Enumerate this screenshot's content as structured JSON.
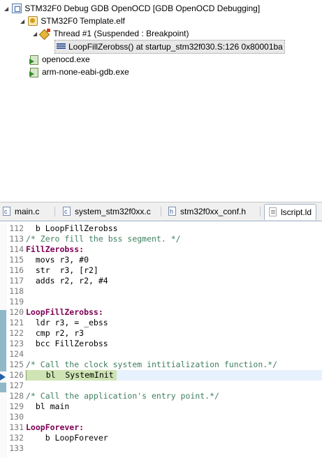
{
  "debug_tree": {
    "launch": {
      "label": "STM32F0 Debug GDB OpenOCD [GDB OpenOCD Debugging]",
      "icon": "launch-config-icon"
    },
    "elf": {
      "label": "STM32F0 Template.elf",
      "icon": "debug-target-icon"
    },
    "thread": {
      "label": "Thread #1 (Suspended : Breakpoint)",
      "icon": "thread-suspended-icon"
    },
    "frame": {
      "label": "LoopFillZerobss() at startup_stm32f030.S:126 0x80001ba",
      "icon": "stack-frame-icon"
    },
    "processes": [
      {
        "label": "openocd.exe",
        "icon": "process-icon"
      },
      {
        "label": "arm-none-eabi-gdb.exe",
        "icon": "process-icon"
      }
    ]
  },
  "editor": {
    "tabs": [
      {
        "label": "main.c",
        "icon": "c-file-icon",
        "active": false
      },
      {
        "label": "system_stm32f0xx.c",
        "icon": "c-file-icon",
        "active": false
      },
      {
        "label": "stm32f0xx_conf.h",
        "icon": "h-file-icon",
        "active": false
      },
      {
        "label": "lscript.ld",
        "icon": "ld-file-icon",
        "active": true
      }
    ],
    "lines": [
      {
        "num": "112",
        "text": "  b LoopFillZerobss",
        "kind": "code"
      },
      {
        "num": "113",
        "text": "/* Zero fill the bss segment. */",
        "kind": "comment"
      },
      {
        "num": "114",
        "text": "FillZerobss:",
        "kind": "label"
      },
      {
        "num": "115",
        "text": "  movs r3, #0",
        "kind": "code"
      },
      {
        "num": "116",
        "text": "  str  r3, [r2]",
        "kind": "code"
      },
      {
        "num": "117",
        "text": "  adds r2, r2, #4",
        "kind": "code"
      },
      {
        "num": "118",
        "text": "",
        "kind": "code"
      },
      {
        "num": "119",
        "text": "",
        "kind": "code"
      },
      {
        "num": "120",
        "text": "LoopFillZerobss:",
        "kind": "label"
      },
      {
        "num": "121",
        "text": "  ldr r3, = _ebss",
        "kind": "code"
      },
      {
        "num": "122",
        "text": "  cmp r2, r3",
        "kind": "code"
      },
      {
        "num": "123",
        "text": "  bcc FillZerobss",
        "kind": "code"
      },
      {
        "num": "124",
        "text": "",
        "kind": "code"
      },
      {
        "num": "125",
        "text": "/* Call the clock system intitialization function.*/",
        "kind": "comment"
      },
      {
        "num": "126",
        "text": "    bl  SystemInit",
        "kind": "highlight"
      },
      {
        "num": "127",
        "text": "",
        "kind": "code"
      },
      {
        "num": "128",
        "text": "/* Call the application's entry point.*/",
        "kind": "comment"
      },
      {
        "num": "129",
        "text": "  bl main",
        "kind": "code"
      },
      {
        "num": "130",
        "text": "",
        "kind": "code"
      },
      {
        "num": "131",
        "text": "LoopForever:",
        "kind": "label"
      },
      {
        "num": "132",
        "text": "    b LoopForever",
        "kind": "code"
      },
      {
        "num": "133",
        "text": "",
        "kind": "code"
      }
    ],
    "current_line": "126",
    "colors": {
      "comment": "#3f7f5f",
      "label": "#7f0055",
      "current_line_highlight": "#cfe4b4",
      "coverage_bar": "#8fb8c8",
      "instruction_pointer": "#2462a8"
    }
  }
}
